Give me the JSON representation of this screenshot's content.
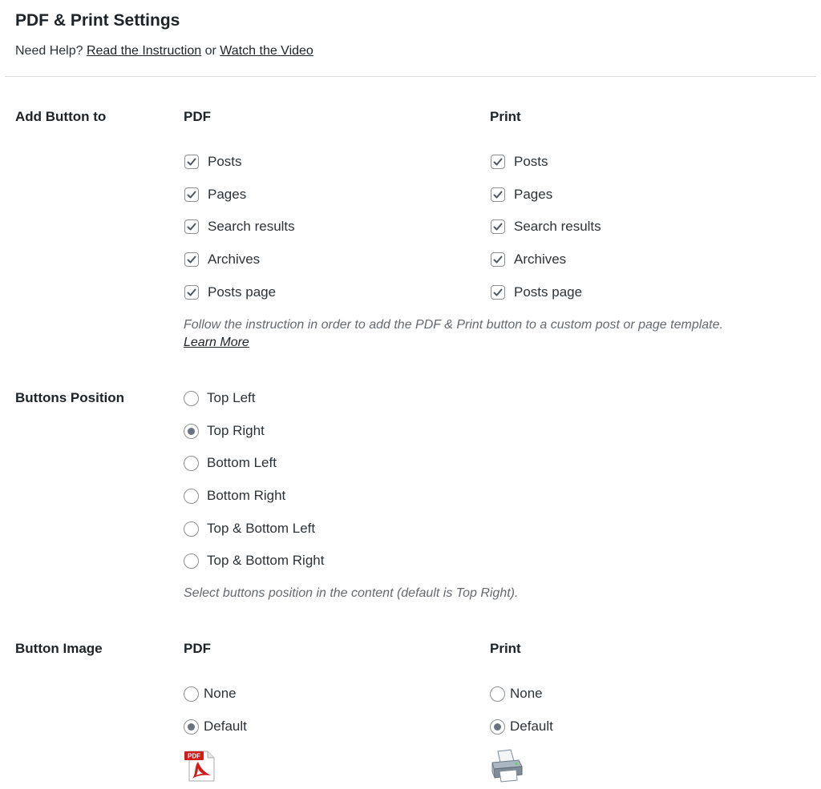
{
  "header": {
    "title": "PDF & Print Settings",
    "help_prefix": "Need Help?",
    "help_link_instruction": "Read the Instruction",
    "help_or": "or",
    "help_link_video": "Watch the Video"
  },
  "add_button_to": {
    "label": "Add Button to",
    "pdf_heading": "PDF",
    "print_heading": "Print",
    "pdf_options": [
      {
        "label": "Posts",
        "checked": true
      },
      {
        "label": "Pages",
        "checked": true
      },
      {
        "label": "Search results",
        "checked": true
      },
      {
        "label": "Archives",
        "checked": true
      },
      {
        "label": "Posts page",
        "checked": true
      }
    ],
    "print_options": [
      {
        "label": "Posts",
        "checked": true
      },
      {
        "label": "Pages",
        "checked": true
      },
      {
        "label": "Search results",
        "checked": true
      },
      {
        "label": "Archives",
        "checked": true
      },
      {
        "label": "Posts page",
        "checked": true
      }
    ],
    "description": "Follow the instruction in order to add the PDF & Print button to a custom post or page template.",
    "learn_more": "Learn More"
  },
  "buttons_position": {
    "label": "Buttons Position",
    "options": [
      "Top Left",
      "Top Right",
      "Bottom Left",
      "Bottom Right",
      "Top & Bottom Left",
      "Top & Bottom Right"
    ],
    "selected": "Top Right",
    "description": "Select buttons position in the content (default is Top Right)."
  },
  "button_image": {
    "label": "Button Image",
    "pdf_heading": "PDF",
    "print_heading": "Print",
    "pdf_options": [
      "None",
      "Default"
    ],
    "pdf_selected": "Default",
    "print_options": [
      "None",
      "Default"
    ],
    "print_selected": "Default",
    "pdf_icon_text": "PDF",
    "pdf_icon": "pdf-file-icon",
    "print_icon": "printer-icon"
  },
  "colors": {
    "text": "#1d2327",
    "muted": "#646970",
    "control_border": "#8c8f94",
    "check_mark": "#50575e",
    "divider": "#dcdcde"
  }
}
